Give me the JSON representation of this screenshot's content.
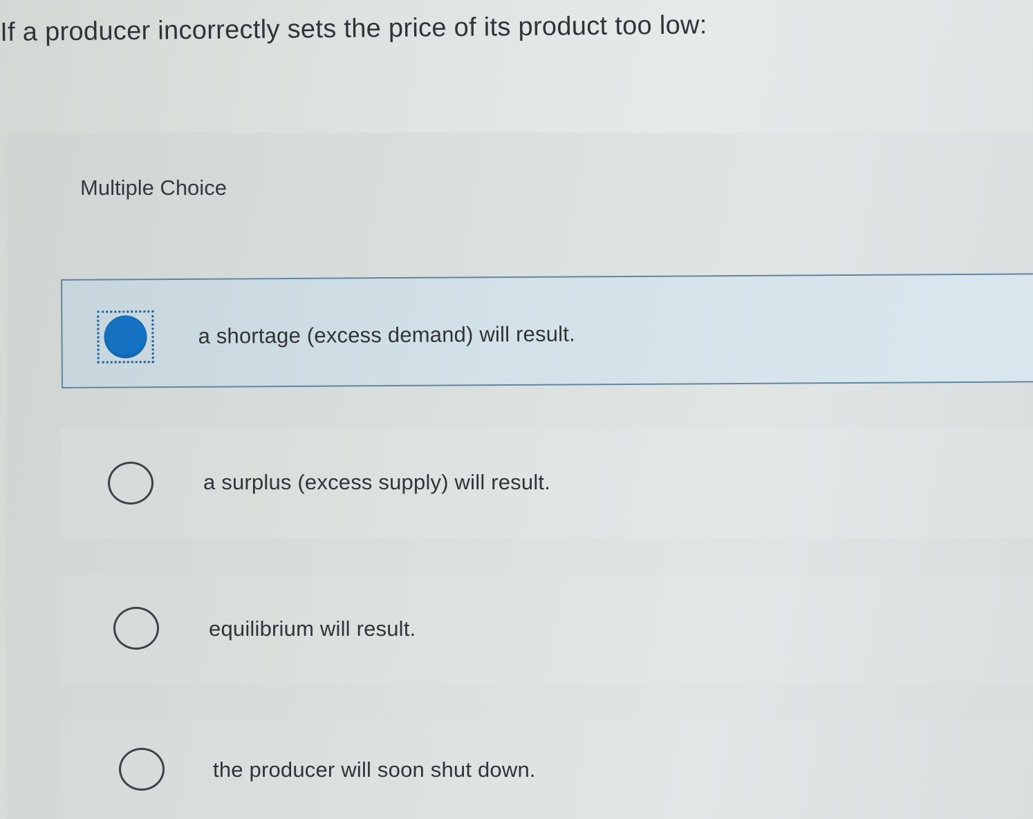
{
  "question": {
    "text": "If a producer incorrectly sets the price of its product too low:"
  },
  "section": {
    "label": "Multiple Choice"
  },
  "options": [
    {
      "label": "a shortage (excess demand) will result.",
      "selected": true
    },
    {
      "label": "a surplus (excess supply) will result.",
      "selected": false
    },
    {
      "label": "equilibrium will result.",
      "selected": false
    },
    {
      "label": "the producer will soon shut down.",
      "selected": false
    }
  ],
  "colors": {
    "selected_radio": "#1572c2",
    "selected_border": "#5f86a4",
    "focus_ring": "#1a5f9e"
  }
}
